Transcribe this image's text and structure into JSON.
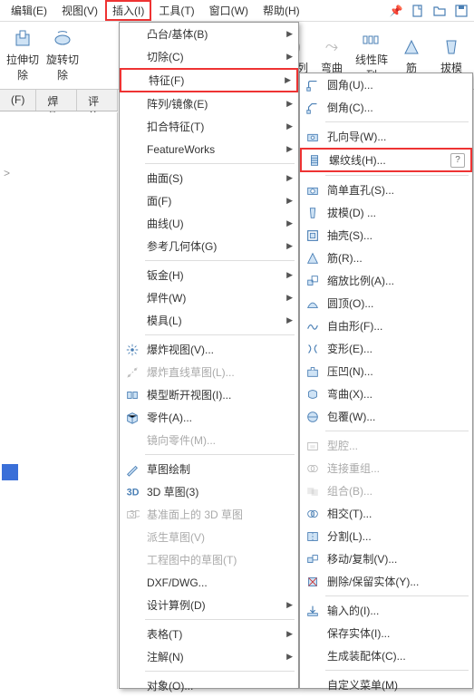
{
  "menubar": {
    "items": [
      {
        "label": "编辑(E)"
      },
      {
        "label": "视图(V)"
      },
      {
        "label": "插入(I)"
      },
      {
        "label": "工具(T)"
      },
      {
        "label": "窗口(W)"
      },
      {
        "label": "帮助(H)"
      }
    ]
  },
  "ribbon": {
    "left": [
      {
        "label": "拉伸切\n除"
      },
      {
        "label": "旋转切\n除"
      }
    ],
    "right": [
      {
        "label": "孔系列"
      },
      {
        "label": "弯曲"
      },
      {
        "label": "线性阵\n列"
      },
      {
        "label": "筋"
      },
      {
        "label": "拔模"
      }
    ]
  },
  "tabs": [
    {
      "label": "(F)"
    },
    {
      "label": "焊件"
    },
    {
      "label": "评估"
    }
  ],
  "menu1": [
    {
      "t": "item",
      "label": "凸台/基体(B)",
      "arrow": true
    },
    {
      "t": "item",
      "label": "切除(C)",
      "arrow": true
    },
    {
      "t": "item",
      "label": "特征(F)",
      "arrow": true,
      "hl": true
    },
    {
      "t": "item",
      "label": "阵列/镜像(E)",
      "arrow": true
    },
    {
      "t": "item",
      "label": "扣合特征(T)",
      "arrow": true
    },
    {
      "t": "item",
      "label": "FeatureWorks",
      "arrow": true
    },
    {
      "t": "sep"
    },
    {
      "t": "item",
      "label": "曲面(S)",
      "arrow": true
    },
    {
      "t": "item",
      "label": "面(F)",
      "arrow": true
    },
    {
      "t": "item",
      "label": "曲线(U)",
      "arrow": true
    },
    {
      "t": "item",
      "label": "参考几何体(G)",
      "arrow": true
    },
    {
      "t": "sep"
    },
    {
      "t": "item",
      "label": "钣金(H)",
      "arrow": true
    },
    {
      "t": "item",
      "label": "焊件(W)",
      "arrow": true
    },
    {
      "t": "item",
      "label": "模具(L)",
      "arrow": true
    },
    {
      "t": "sep"
    },
    {
      "t": "item",
      "label": "爆炸视图(V)...",
      "icon": "explode"
    },
    {
      "t": "item",
      "label": "爆炸直线草图(L)...",
      "icon": "explode-line",
      "dim": true
    },
    {
      "t": "item",
      "label": "模型断开视图(I)...",
      "icon": "break"
    },
    {
      "t": "item",
      "label": "零件(A)...",
      "icon": "part"
    },
    {
      "t": "item",
      "label": "镜向零件(M)...",
      "dim": true
    },
    {
      "t": "sep"
    },
    {
      "t": "item",
      "label": "草图绘制",
      "icon": "sketch"
    },
    {
      "t": "item",
      "label": "3D 草图(3)",
      "icon": "sketch3d"
    },
    {
      "t": "item",
      "label": "基准面上的 3D 草图",
      "icon": "sketch3d-plane",
      "dim": true
    },
    {
      "t": "item",
      "label": "派生草图(V)",
      "dim": true
    },
    {
      "t": "item",
      "label": "工程图中的草图(T)",
      "dim": true
    },
    {
      "t": "item",
      "label": "DXF/DWG...",
      "arrow": false
    },
    {
      "t": "item",
      "label": "设计算例(D)",
      "arrow": true
    },
    {
      "t": "sep"
    },
    {
      "t": "item",
      "label": "表格(T)",
      "arrow": true
    },
    {
      "t": "item",
      "label": "注解(N)",
      "arrow": true
    },
    {
      "t": "sep"
    },
    {
      "t": "item",
      "label": "对象(O)..."
    }
  ],
  "menu2": [
    {
      "t": "item",
      "label": "圆角(U)...",
      "icon": "fillet"
    },
    {
      "t": "item",
      "label": "倒角(C)...",
      "icon": "chamfer"
    },
    {
      "t": "sep"
    },
    {
      "t": "item",
      "label": "孔向导(W)...",
      "icon": "hole-wizard"
    },
    {
      "t": "item",
      "label": "螺纹线(H)...",
      "icon": "thread",
      "hl": true,
      "badge": true
    },
    {
      "t": "sep"
    },
    {
      "t": "item",
      "label": "简单直孔(S)...",
      "icon": "simple-hole"
    },
    {
      "t": "item",
      "label": "拔模(D) ...",
      "icon": "draft"
    },
    {
      "t": "item",
      "label": "抽壳(S)...",
      "icon": "shell"
    },
    {
      "t": "item",
      "label": "筋(R)...",
      "icon": "rib"
    },
    {
      "t": "item",
      "label": "缩放比例(A)...",
      "icon": "scale"
    },
    {
      "t": "item",
      "label": "圆顶(O)...",
      "icon": "dome"
    },
    {
      "t": "item",
      "label": "自由形(F)...",
      "icon": "freeform"
    },
    {
      "t": "item",
      "label": "变形(E)...",
      "icon": "deform"
    },
    {
      "t": "item",
      "label": "压凹(N)...",
      "icon": "indent"
    },
    {
      "t": "item",
      "label": "弯曲(X)...",
      "icon": "flex"
    },
    {
      "t": "item",
      "label": "包覆(W)...",
      "icon": "wrap"
    },
    {
      "t": "sep"
    },
    {
      "t": "item",
      "label": "型腔...",
      "icon": "cavity",
      "dim": true
    },
    {
      "t": "item",
      "label": "连接重组...",
      "icon": "join",
      "dim": true
    },
    {
      "t": "item",
      "label": "组合(B)...",
      "icon": "combine",
      "dim": true
    },
    {
      "t": "item",
      "label": "相交(T)...",
      "icon": "intersect"
    },
    {
      "t": "item",
      "label": "分割(L)...",
      "icon": "split"
    },
    {
      "t": "item",
      "label": "移动/复制(V)...",
      "icon": "move-copy"
    },
    {
      "t": "item",
      "label": "删除/保留实体(Y)...",
      "icon": "delete-body"
    },
    {
      "t": "sep"
    },
    {
      "t": "item",
      "label": "输入的(I)...",
      "icon": "imported"
    },
    {
      "t": "item",
      "label": "保存实体(I)...",
      "dim": false
    },
    {
      "t": "item",
      "label": "生成装配体(C)...",
      "dim": false
    },
    {
      "t": "sep"
    },
    {
      "t": "item",
      "label": "自定义菜单(M)"
    }
  ]
}
